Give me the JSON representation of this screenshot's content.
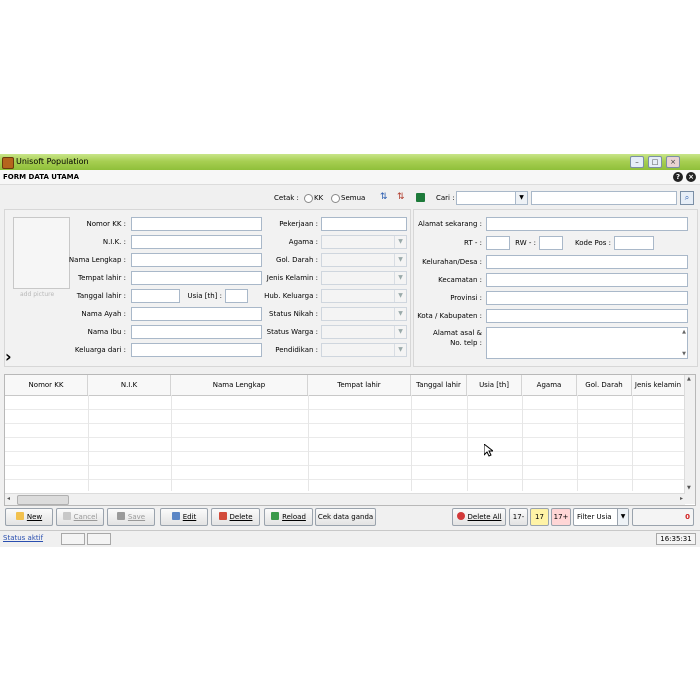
{
  "window": {
    "title": "Unisoft Population",
    "form_title": "FORM DATA UTAMA"
  },
  "toolbar": {
    "cetak_label": "Cetak :",
    "radio_kk": "KK",
    "radio_semua": "Semua",
    "cari_label": "Cari :",
    "cari_value": "",
    "search_value": ""
  },
  "photo": {
    "label": "add picture"
  },
  "left_fields": [
    {
      "label": "Nomor KK :",
      "value": ""
    },
    {
      "label": "N.I.K. :",
      "value": ""
    },
    {
      "label": "Nama Lengkap :",
      "value": ""
    },
    {
      "label": "Tempat lahir :",
      "value": ""
    },
    {
      "label": "Tanggal lahir :",
      "value": ""
    },
    {
      "label": "Nama Ayah :",
      "value": ""
    },
    {
      "label": "Nama Ibu :",
      "value": ""
    },
    {
      "label": "Keluarga dari :",
      "value": ""
    }
  ],
  "usia_label": "Usia [th] :",
  "mid_fields": [
    {
      "label": "Pekerjaan :",
      "value": ""
    },
    {
      "label": "Agama :",
      "value": ""
    },
    {
      "label": "Gol. Darah :",
      "value": ""
    },
    {
      "label": "Jenis Kelamin :",
      "value": ""
    },
    {
      "label": "Hub. Keluarga :",
      "value": ""
    },
    {
      "label": "Status Nikah :",
      "value": ""
    },
    {
      "label": "Status Warga :",
      "value": ""
    },
    {
      "label": "Pendidikan :",
      "value": ""
    }
  ],
  "right_fields": {
    "alamat": "Alamat sekarang :",
    "rt": "RT - :",
    "rw": "RW - :",
    "kodepos": "Kode Pos :",
    "kelurahan": "Kelurahan/Desa :",
    "kecamatan": "Kecamatan :",
    "provinsi": "Provinsi :",
    "kota": "Kota / Kabupaten :",
    "alamat_asal_1": "Alamat asal &",
    "alamat_asal_2": "No. telp :"
  },
  "table": {
    "columns": [
      "Nomor KK",
      "N.I.K",
      "Nama Lengkap",
      "Tempat lahir",
      "Tanggal lahir",
      "Usia [th]",
      "Agama",
      "Gol. Darah",
      "Jenis kelamin"
    ],
    "rows": []
  },
  "buttons": {
    "new": "New",
    "cancel": "Cancel",
    "save": "Save",
    "edit": "Edit",
    "delete": "Delete",
    "reload": "Reload",
    "cek": "Cek data ganda",
    "delete_all": "Delete All",
    "b17minus": "17-",
    "b17": "17",
    "b17plus": "17+",
    "filter": "Filter Usia",
    "count": "0"
  },
  "status": {
    "text": "Status aktif",
    "time": "16:35:31"
  },
  "colors": {
    "titlebar": "#a7cf52",
    "accent_red": "#d22020",
    "badge_yellow": "#fff3a6",
    "badge_pink": "#ffd6d6"
  }
}
